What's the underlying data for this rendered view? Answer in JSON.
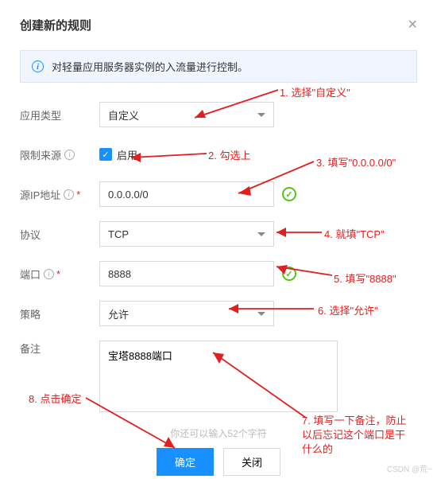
{
  "header": {
    "title": "创建新的规则",
    "close": "×"
  },
  "info": {
    "text": "对轻量应用服务器实例的入流量进行控制。"
  },
  "form": {
    "appType": {
      "label": "应用类型",
      "value": "自定义"
    },
    "limitSource": {
      "label": "限制来源",
      "enable": "启用"
    },
    "sourceIp": {
      "label": "源IP地址",
      "value": "0.0.0.0/0"
    },
    "protocol": {
      "label": "协议",
      "value": "TCP"
    },
    "port": {
      "label": "端口",
      "value": "8888"
    },
    "policy": {
      "label": "策略",
      "value": "允许"
    },
    "remark": {
      "label": "备注",
      "value": "宝塔8888端口"
    }
  },
  "hint": "你还可以输入52个字符",
  "buttons": {
    "ok": "确定",
    "close": "关闭"
  },
  "annotations": {
    "a1": "1. 选择\"自定义\"",
    "a2": "2. 勾选上",
    "a3": "3. 填写\"0.0.0.0/0\"",
    "a4": "4. 就填\"TCP\"",
    "a5": "5. 填写\"8888\"",
    "a6": "6. 选择\"允许\"",
    "a7": "7. 填写一下备注，防止以后忘记这个端口是干什么的",
    "a8": "8. 点击确定"
  },
  "watermark": "CSDN @荒~"
}
